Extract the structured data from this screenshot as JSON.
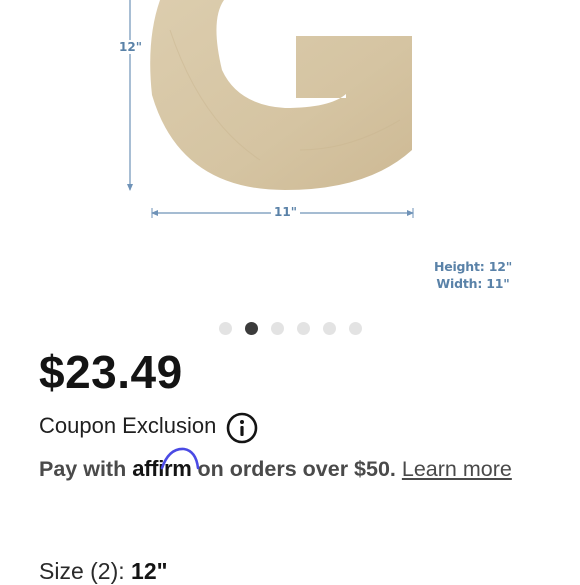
{
  "gallery": {
    "dimensions": {
      "height_marker": "12\"",
      "width_marker": "11\"",
      "height_text": "Height: 12\"",
      "width_text": "Width: 11\""
    },
    "dot_count": 6,
    "active_dot": 1
  },
  "price": "$23.49",
  "coupon": {
    "label": "Coupon Exclusion",
    "icon": "info-icon"
  },
  "financing": {
    "prefix": "Pay with",
    "brand": "affirm",
    "suffix": "on orders over $50.",
    "link_label": "Learn more"
  },
  "size": {
    "label": "Size (2):",
    "value": "12\""
  },
  "colors": {
    "wood": "#d8c8a8",
    "dimension_text": "#5a82a8",
    "affirm_arc": "#4a4ae4",
    "active_dot": "#3b3b3b"
  }
}
